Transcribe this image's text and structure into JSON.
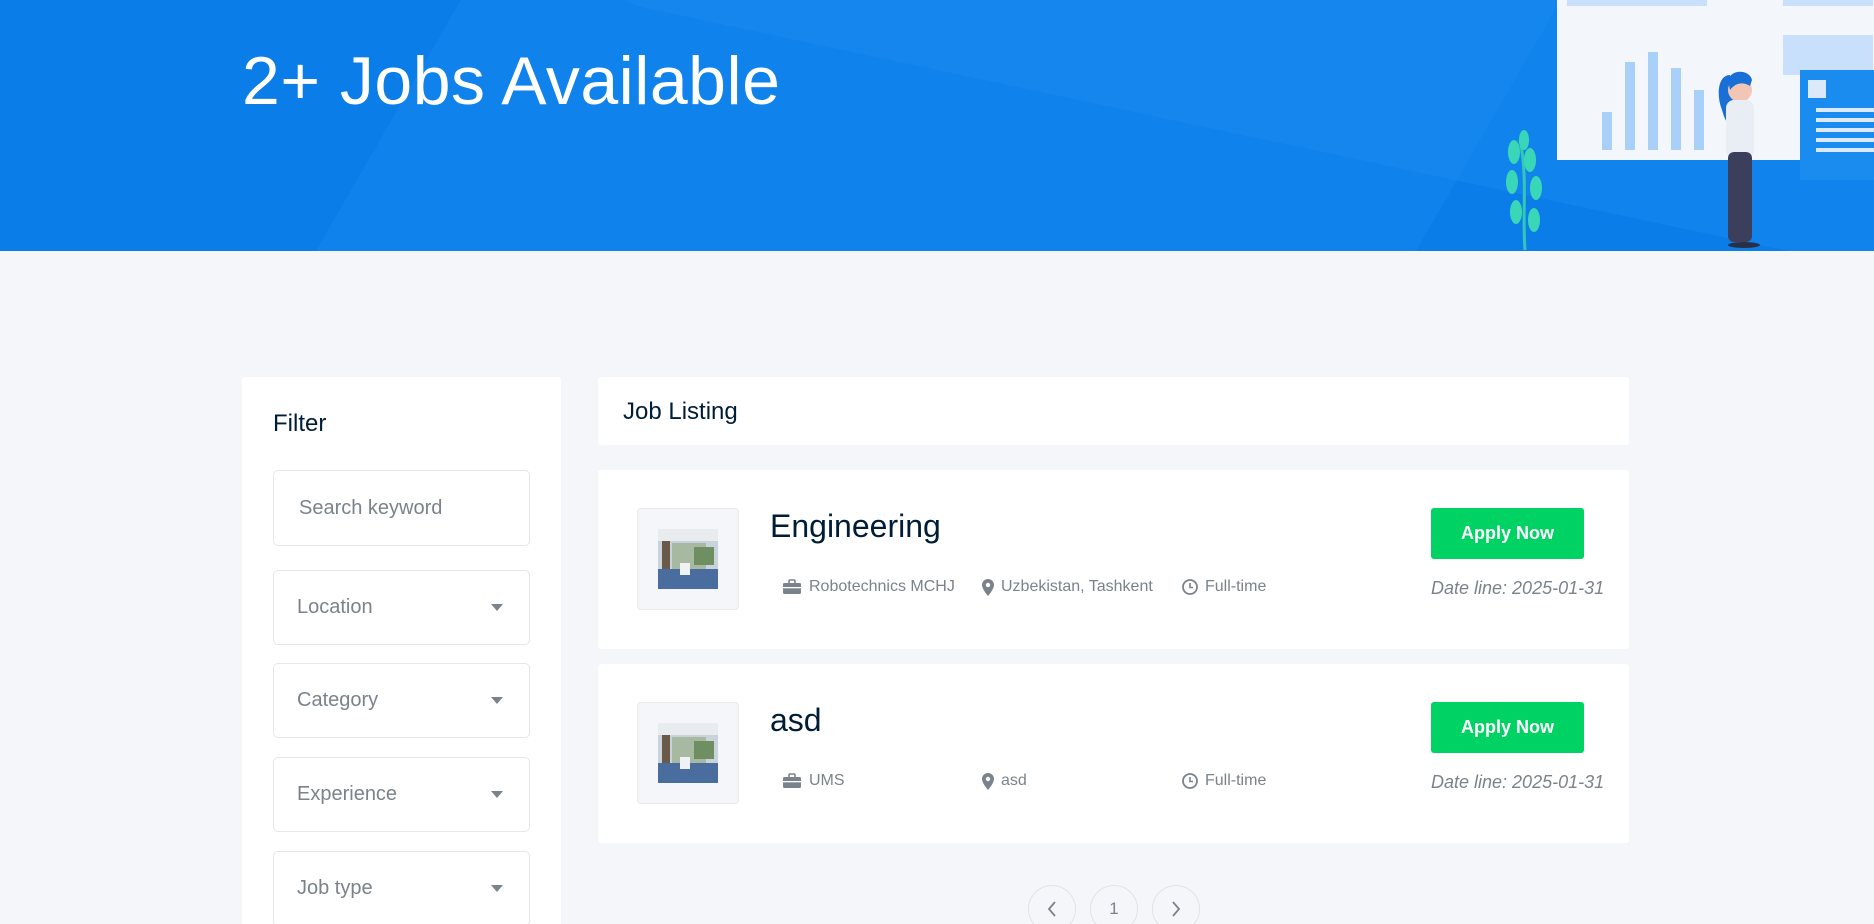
{
  "hero": {
    "title": "2+ Jobs Available"
  },
  "filter": {
    "title": "Filter",
    "search_placeholder": "Search keyword",
    "selects": [
      "Location",
      "Category",
      "Experience",
      "Job type"
    ]
  },
  "listing": {
    "header": "Job Listing",
    "apply_label": "Apply Now",
    "jobs": [
      {
        "title": "Engineering",
        "company": "Robotechnics MCHJ",
        "location": "Uzbekistan, Tashkent",
        "type": "Full-time",
        "dateline": "Date line: 2025-01-31"
      },
      {
        "title": "asd",
        "company": "UMS",
        "location": "asd",
        "type": "Full-time",
        "dateline": "Date line: 2025-01-31"
      }
    ]
  },
  "pagination": {
    "prev": "‹",
    "current": "1",
    "next": "›"
  },
  "colors": {
    "hero_bg": "#0a7de8",
    "apply_btn": "#00d363",
    "heading": "#001d38",
    "muted": "#7a838b",
    "page_bg": "#f5f6fa"
  }
}
